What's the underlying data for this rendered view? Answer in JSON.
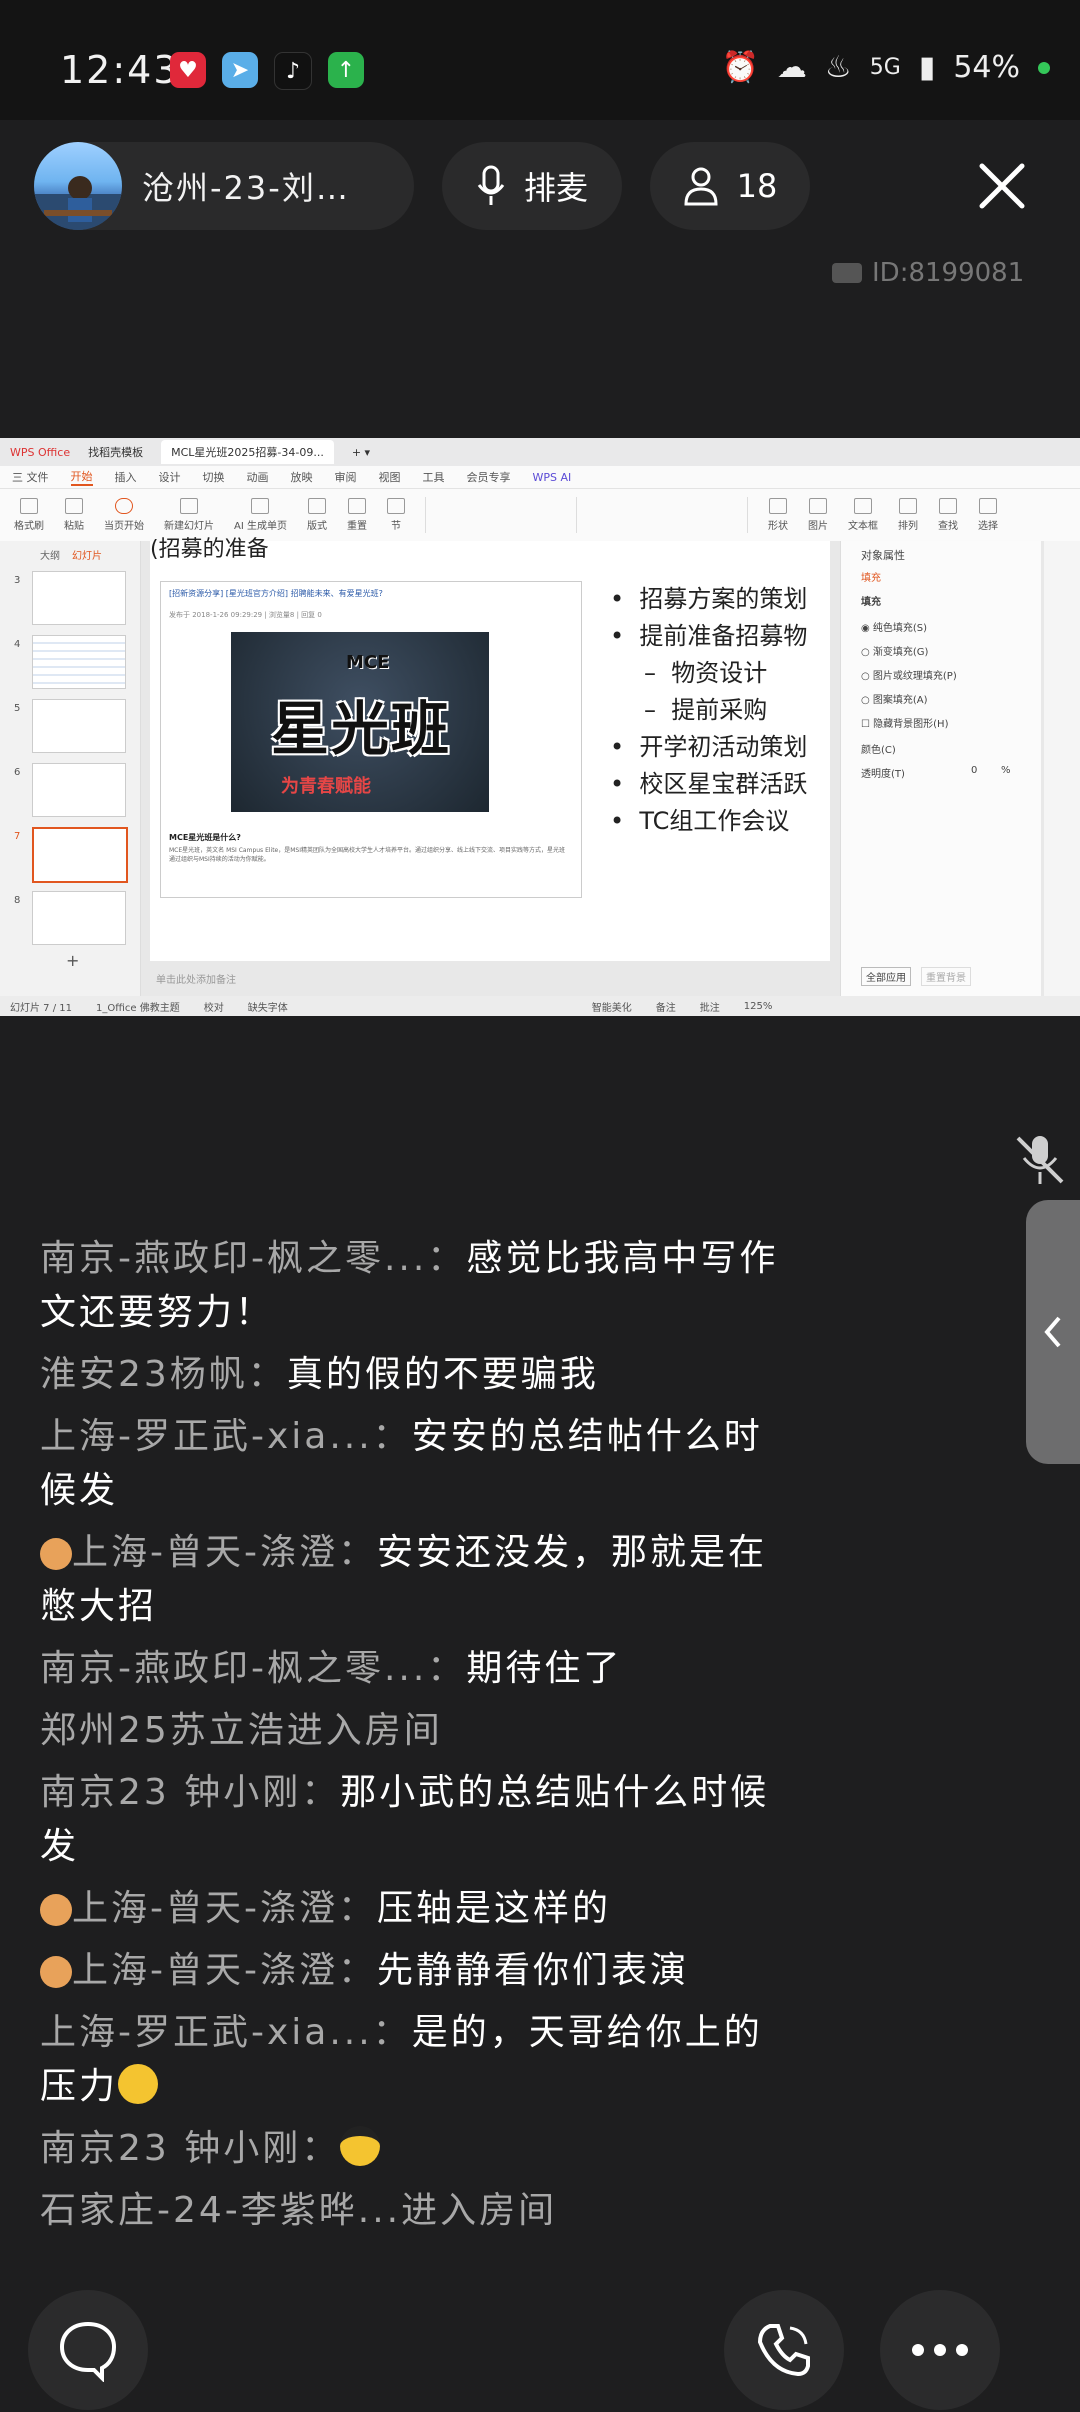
{
  "status": {
    "time": "12:43",
    "network": "5G",
    "battery": "54%",
    "app_icons": [
      "red-app-icon",
      "telegram-icon",
      "tiktok-icon",
      "green-upload-icon"
    ],
    "system_icons": [
      "alarm-icon",
      "notification-icon",
      "cake-icon",
      "signal-icon",
      "battery-icon"
    ]
  },
  "room": {
    "host_name": "沧州-23-刘…",
    "mic_label": "排麦",
    "participants": "18",
    "room_id": "ID:8199081"
  },
  "wps": {
    "app_tab": "WPS Office",
    "tab2": "找稻壳模板",
    "tab3": "MCL星光班2025招募-34-09...",
    "menu": [
      "三 文件",
      "开始",
      "插入",
      "设计",
      "切换",
      "动画",
      "放映",
      "审阅",
      "视图",
      "工具",
      "会员专享",
      "WPS AI"
    ],
    "ribbon": [
      "格式刷",
      "粘贴",
      "当页开始",
      "新建幻灯片",
      "AI 生成单页",
      "版式",
      "重置",
      "节",
      "形状",
      "图片",
      "文本框",
      "排列",
      "查找",
      "选择"
    ],
    "panel_tabs": [
      "大纲",
      "幻灯片"
    ],
    "thumb_numbers": [
      "3",
      "4",
      "5",
      "6",
      "7",
      "8"
    ],
    "slide_heading": "(招募的准备",
    "card_header": "[招新资源分享] [星光班官方介绍] 招聘能未来、有爱星光班?",
    "card_meta": "发布于 2018-1-26 09:29:29 | 浏览量8 | 回复 0",
    "poster_title": "星光班",
    "poster_brand": "MCE",
    "poster_sub": "为青春赋能",
    "card_q": "MCE星光班是什么?",
    "card_desc": "MCE星光班，英文名 MSI Campus Elite，是MSI精英团队为全国高校大学生人才培养平台。通过组织分享、线上线下交流、项目实践等方式，星光班通过组织与MSI持续的活动为你赋能。",
    "bullets": [
      {
        "text": "招募方案的策划",
        "sub": false
      },
      {
        "text": "提前准备招募物",
        "sub": false
      },
      {
        "text": "物资设计",
        "sub": true
      },
      {
        "text": "提前采购",
        "sub": true
      },
      {
        "text": "开学初活动策划",
        "sub": false
      },
      {
        "text": "校区星宝群活跃",
        "sub": false
      },
      {
        "text": "TC组工作会议",
        "sub": false
      }
    ],
    "props_title": "对象属性",
    "props_tab": "填充",
    "props_section": "填充",
    "props_options": [
      "纯色填充(S)",
      "渐变填充(G)",
      "图片或纹理填充(P)",
      "图案填充(A)",
      "隐藏背景图形(H)"
    ],
    "props_color": "颜色(C)",
    "props_transparency": "透明度(T)",
    "props_transparency_val": "0",
    "props_pct": "%",
    "props_apply": "全部应用",
    "props_reset": "重置背景",
    "notes_placeholder": "单击此处添加备注",
    "status_left": "幻灯片 7 / 11",
    "status_theme": "1_Office 佛教主题",
    "status_check": "校对",
    "status_font": "缺失字体",
    "status_beautify": "智能美化",
    "status_notes": "备注",
    "status_comment": "批注",
    "zoom": "125%"
  },
  "chat": [
    {
      "name": "南京-燕政印-枫之零...：",
      "text": "感觉比我高中写作文还要努力！",
      "emoji": ""
    },
    {
      "name": "淮安23杨帆：",
      "text": "真的假的不要骗我",
      "emoji": ""
    },
    {
      "name": "上海-罗正武-xia...：",
      "text": "安安的总结帖什么时候发",
      "emoji": ""
    },
    {
      "name": "上海-曾天-涤澄：",
      "text": "安安还没发，那就是在憋大招",
      "emoji": "",
      "badge": true
    },
    {
      "name": "南京-燕政印-枫之零...：",
      "text": "期待住了",
      "emoji": ""
    },
    {
      "name": "郑州25苏立浩进入房间",
      "text": "",
      "emoji": ""
    },
    {
      "name": "南京23 钟小刚：",
      "text": "那小武的总结贴什么时候发",
      "emoji": ""
    },
    {
      "name": "上海-曾天-涤澄：",
      "text": "压轴是这样的",
      "emoji": "",
      "badge": true
    },
    {
      "name": "上海-曾天-涤澄：",
      "text": "先静静看你们表演",
      "emoji": "",
      "badge": true
    },
    {
      "name": "上海-罗正武-xia...：",
      "text": "是的，天哥给你上的压力",
      "emoji": "grin"
    },
    {
      "name": "南京23 钟小刚：",
      "text": "",
      "emoji": "cool"
    },
    {
      "name": "石家庄-24-李紫晔...进入房间",
      "text": "",
      "emoji": ""
    }
  ],
  "colors": {
    "bg": "#1e1e1f",
    "pill": "#2a2a2b",
    "wps_accent": "#e1561f",
    "online": "#34c759"
  }
}
